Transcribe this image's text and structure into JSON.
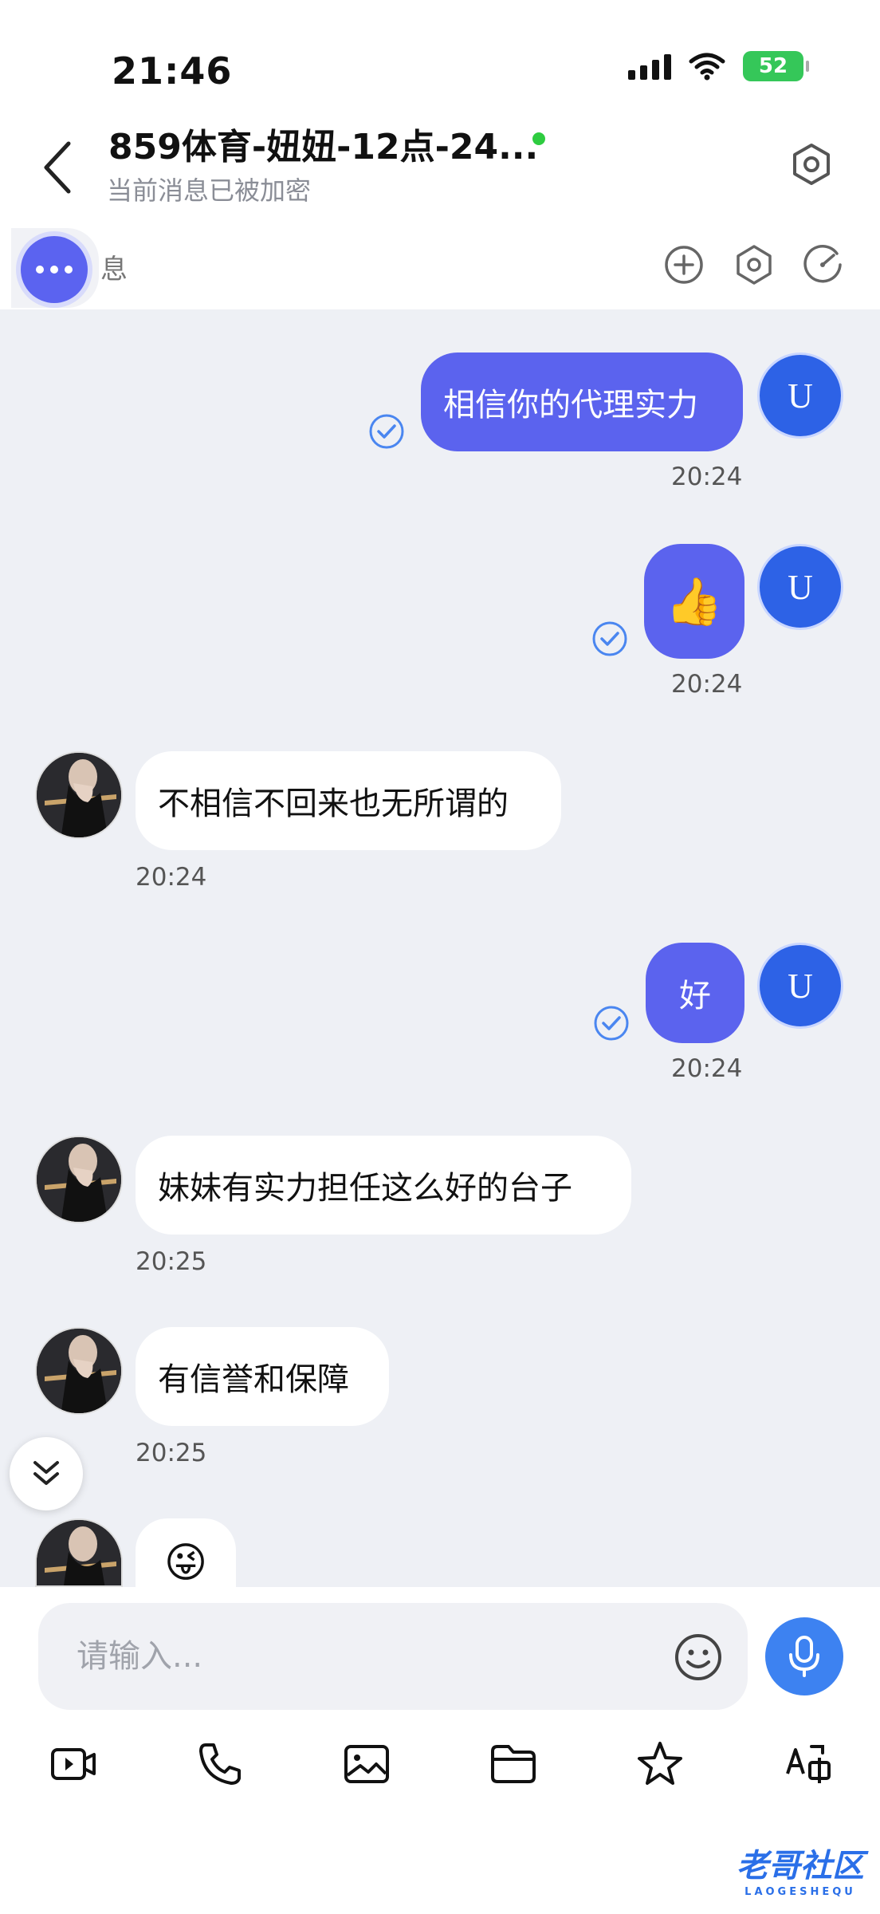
{
  "status_bar": {
    "time": "21:46",
    "battery": "52"
  },
  "header": {
    "title": "859体育-妞妞-12点-24...",
    "subtitle": "当前消息已被加密"
  },
  "pinned": {
    "text": "息"
  },
  "messages": [
    {
      "direction": "out",
      "text": "相信你的代理实力",
      "time": "20:24",
      "avatar": "U"
    },
    {
      "direction": "out",
      "text": "👍",
      "time": "20:24",
      "avatar": "U"
    },
    {
      "direction": "in",
      "text": "不相信不回来也无所谓的",
      "time": "20:24"
    },
    {
      "direction": "out",
      "text": "好",
      "time": "20:24",
      "avatar": "U"
    },
    {
      "direction": "in",
      "text": "妹妹有实力担任这么好的台子",
      "time": "20:25"
    },
    {
      "direction": "in",
      "text": "有信誉和保障",
      "time": "20:25"
    },
    {
      "direction": "in",
      "text": "😜",
      "time": ""
    }
  ],
  "composer": {
    "placeholder": "请输入..."
  },
  "toolbar": [
    "video-icon",
    "phone-icon",
    "image-icon",
    "folder-icon",
    "star-icon",
    "translate-icon"
  ],
  "watermark": {
    "text": "老哥社区",
    "sub": "LAOGESHEQU"
  },
  "colors": {
    "accent": "#5b63ee",
    "avatar_blue": "#2d62e6",
    "mic_blue": "#3d82f1",
    "online": "#2ecc40"
  }
}
